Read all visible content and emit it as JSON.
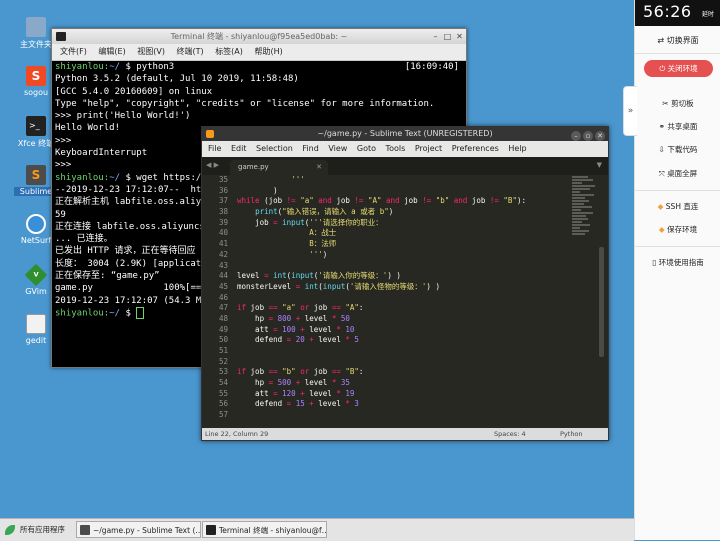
{
  "desktop": {
    "icons": [
      {
        "label": "主文件夹",
        "icon": "folder-icon",
        "color": "#7f9fbf"
      },
      {
        "label": "sogou",
        "icon": "sogou-icon",
        "color": "#f04a24"
      },
      {
        "label": "Xfce 终端",
        "icon": "terminal-icon",
        "color": "#222222"
      },
      {
        "label": "Sublime",
        "icon": "sublime-icon",
        "color": "#f89a1a"
      },
      {
        "label": "NetSurf",
        "icon": "globe-icon",
        "color": "#3b8ed8"
      },
      {
        "label": "GVim",
        "icon": "vim-icon",
        "color": "#3a9a3a"
      },
      {
        "label": "gedit",
        "icon": "gedit-icon",
        "color": "#dddddd"
      }
    ]
  },
  "terminal": {
    "title": "Terminal 终端 - shiyanlou@f95ea5ed0bab: ~",
    "menu": [
      "文件(F)",
      "编辑(E)",
      "视图(V)",
      "终端(T)",
      "标签(A)",
      "帮助(H)"
    ],
    "lines": [
      {
        "user": "shiyanlou:",
        "path": "~/",
        "cmd": " $ python3",
        "right": "[16:09:40]"
      },
      {
        "text": "Python 3.5.2 (default, Jul 10 2019, 11:58:48)"
      },
      {
        "text": "[GCC 5.4.0 20160609] on linux"
      },
      {
        "text": "Type \"help\", \"copyright\", \"credits\" or \"license\" for more information."
      },
      {
        "text": ">>> print('Hello World!')"
      },
      {
        "text": "Hello World!"
      },
      {
        "text": ">>>"
      },
      {
        "text": "KeyboardInterrupt"
      },
      {
        "text": ">>>"
      },
      {
        "user": "shiyanlou:",
        "path": "~/",
        "cmd": " $ wget https://l"
      },
      {
        "text": "--2019-12-23 17:12:07--  http"
      },
      {
        "text": "正在解析主机 labfile.oss.aliyunc"
      },
      {
        "text": "59"
      },
      {
        "text": "正在连接 labfile.oss.aliyuncs"
      },
      {
        "text": "... 已连接。"
      },
      {
        "text": "已发出 HTTP 请求，正在等待回应"
      },
      {
        "text": "长度： 3004 (2.9K) [applicati"
      },
      {
        "text": "正在保存至: “game.py”"
      },
      {
        "text": ""
      },
      {
        "text": "game.py             100%[===="
      },
      {
        "text": ""
      },
      {
        "text": "2019-12-23 17:12:07 (54.3 MB/"
      },
      {
        "text": ""
      },
      {
        "user": "shiyanlou:",
        "path": "~/",
        "cmd": " $ ",
        "cursor": true
      }
    ]
  },
  "sublime": {
    "title": "~/game.py - Sublime Text (UNREGISTERED)",
    "menu": [
      "File",
      "Edit",
      "Selection",
      "Find",
      "View",
      "Goto",
      "Tools",
      "Project",
      "Preferences",
      "Help"
    ],
    "tab": "game.py",
    "line_numbers": [
      "35",
      "36",
      "37",
      "38",
      "39",
      "40",
      "41",
      "42",
      "43",
      "44",
      "45",
      "46",
      "47",
      "48",
      "49",
      "50",
      "51",
      "52",
      "53",
      "54",
      "55",
      "56",
      "57"
    ],
    "status": {
      "position": "Line 22, Column 29",
      "spaces": "Spaces: 4",
      "syntax": "Python"
    }
  },
  "panel": {
    "timer": "56:26",
    "extend": "延时",
    "switch": "切换界面",
    "close": "关闭环境",
    "items": [
      "剪切板",
      "共享桌面",
      "下载代码",
      "桌面全屏",
      "SSH 直连",
      "保存环境",
      "环境使用指南"
    ]
  },
  "taskbar": {
    "start": "所有应用程序",
    "tasks": [
      "~/game.py - Sublime Text (…",
      "Terminal 终端 - shiyanlou@f…"
    ]
  }
}
